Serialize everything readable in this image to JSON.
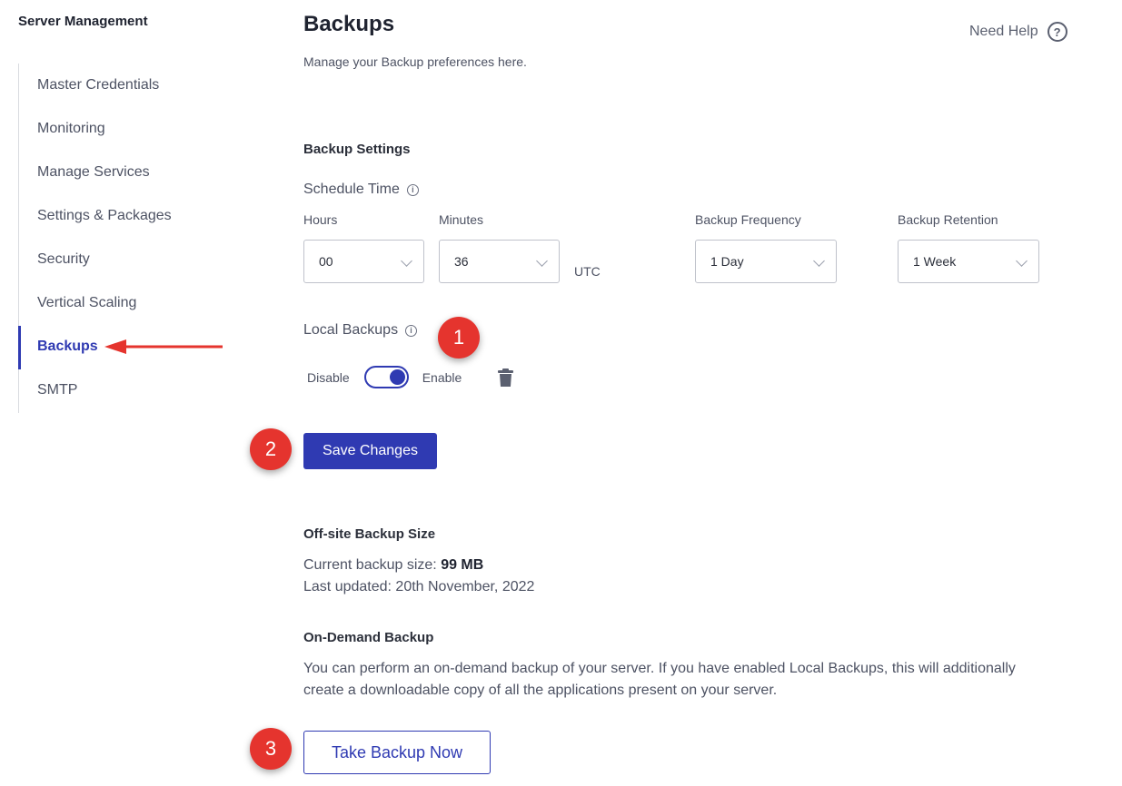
{
  "sidebar": {
    "title": "Server Management",
    "items": [
      {
        "label": "Master Credentials"
      },
      {
        "label": "Monitoring"
      },
      {
        "label": "Manage Services"
      },
      {
        "label": "Settings & Packages"
      },
      {
        "label": "Security"
      },
      {
        "label": "Vertical Scaling"
      },
      {
        "label": "Backups",
        "active": true
      },
      {
        "label": "SMTP"
      }
    ]
  },
  "header": {
    "title": "Backups",
    "subtitle": "Manage your Backup preferences here.",
    "help_label": "Need Help",
    "help_icon": "?"
  },
  "backup_settings": {
    "heading": "Backup Settings",
    "schedule_label": "Schedule Time",
    "hours_label": "Hours",
    "hours_value": "00",
    "minutes_label": "Minutes",
    "minutes_value": "36",
    "timezone": "UTC",
    "frequency_label": "Backup Frequency",
    "frequency_value": "1 Day",
    "retention_label": "Backup Retention",
    "retention_value": "1 Week",
    "local_backups_label": "Local Backups",
    "toggle_off_label": "Disable",
    "toggle_on_label": "Enable",
    "local_backups_enabled": true,
    "save_label": "Save Changes"
  },
  "offsite": {
    "heading": "Off-site Backup Size",
    "size_prefix": "Current backup size: ",
    "size_value": "99 MB",
    "updated_text": "Last updated: 20th November, 2022"
  },
  "on_demand": {
    "heading": "On-Demand Backup",
    "description": "You can perform an on-demand backup of your server. If you have enabled Local Backups, this will additionally create a downloadable copy of all the applications present on your server.",
    "button_label": "Take Backup Now"
  },
  "annotations": {
    "badge_1": "1",
    "badge_2": "2",
    "badge_3": "3",
    "badge_color": "#e5342e",
    "arrow_color": "#e5342e"
  },
  "colors": {
    "accent": "#2f3ab2"
  },
  "icons": {
    "info": "i",
    "trash": "trash-icon",
    "help": "help-circle-icon",
    "chevron": "chevron-down-icon"
  }
}
